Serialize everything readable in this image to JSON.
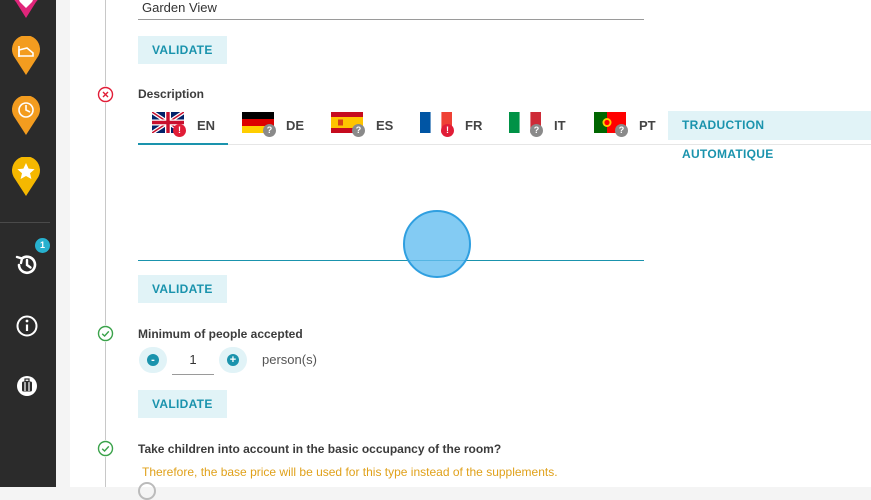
{
  "sidebar": {
    "icons": [
      {
        "name": "heart-pin-icon",
        "color": "#e0257a"
      },
      {
        "name": "hotel-pin-icon",
        "color": "#f39c1f"
      },
      {
        "name": "clock-pin-icon",
        "color": "#f39c1f"
      },
      {
        "name": "star-pin-icon",
        "color": "#f5b800"
      },
      {
        "name": "history-icon"
      },
      {
        "name": "info-icon"
      },
      {
        "name": "luggage-icon"
      }
    ],
    "history_badge": "1"
  },
  "form": {
    "name_field": {
      "value": "Garden View",
      "validate_label": "VALIDATE"
    },
    "description": {
      "label": "Description",
      "status": "error",
      "tabs": [
        {
          "lang": "EN",
          "flag": "uk-flag-icon",
          "status": "!"
        },
        {
          "lang": "DE",
          "flag": "germany-flag-icon",
          "status": "?"
        },
        {
          "lang": "ES",
          "flag": "spain-flag-icon",
          "status": "?"
        },
        {
          "lang": "FR",
          "flag": "france-flag-icon",
          "status": "!"
        },
        {
          "lang": "IT",
          "flag": "italy-flag-icon",
          "status": "?"
        },
        {
          "lang": "PT",
          "flag": "portugal-flag-icon",
          "status": "?"
        }
      ],
      "auto_translate_label": "TRADUCTION AUTOMATIQUE",
      "validate_label": "VALIDATE"
    },
    "min_people": {
      "label": "Minimum of people accepted",
      "status": "ok",
      "minus": "-",
      "plus": "+",
      "value": "1",
      "unit": "person(s)",
      "validate_label": "VALIDATE"
    },
    "children": {
      "label": "Take children into account in the basic occupancy of the room?",
      "status": "ok",
      "hint": "Therefore, the base price will be used for this type instead of the supplements."
    }
  },
  "colors": {
    "accent": "#1a93ad",
    "error": "#e11d37",
    "ok": "#3aa24a",
    "warning": "#e0a11a"
  }
}
